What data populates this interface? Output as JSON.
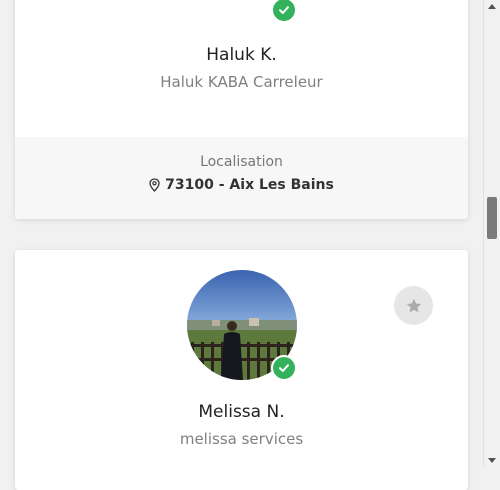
{
  "cards": [
    {
      "name": "Haluk K.",
      "company": "Haluk KABA Carreleur",
      "verified": true,
      "location_label": "Localisation",
      "location_value": "73100 - Aix Les Bains"
    },
    {
      "name": "Melissa N.",
      "company": "melissa services",
      "verified": true,
      "has_avatar": true
    }
  ],
  "colors": {
    "verified_green": "#34b25b",
    "favorite_button_bg": "#e6e6e6",
    "favorite_star": "#ababab"
  },
  "icons": {
    "verified": "check-icon",
    "location": "map-pin-icon",
    "favorite": "star-icon"
  }
}
